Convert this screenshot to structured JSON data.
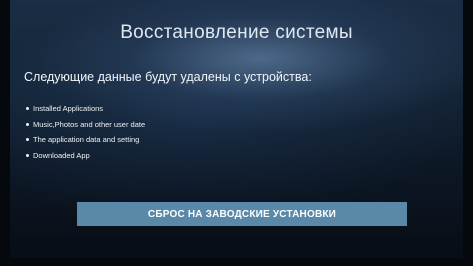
{
  "header": {
    "title": "Восстановление системы"
  },
  "main": {
    "subtitle": "Следующие данные будут удалены с устройства:",
    "items": [
      {
        "label": "Installed Applications"
      },
      {
        "label": "Music,Photos and other user date"
      },
      {
        "label": "The application data and setting"
      },
      {
        "label": "Downloaded App"
      }
    ],
    "reset_button_label": "СБРОС НА ЗАВОДСКИЕ УСТАНОВКИ"
  },
  "colors": {
    "button_background": "#5a88a8",
    "background_top": "#1b2d45",
    "background_bottom": "#070c14"
  },
  "icons": {
    "bullet": "bullet-dot-icon"
  }
}
